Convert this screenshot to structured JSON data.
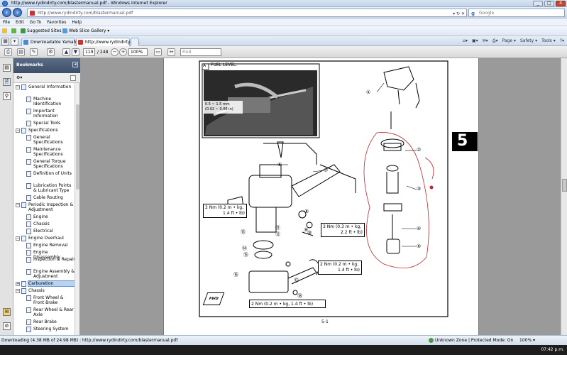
{
  "window": {
    "title": "http://www.rydindirty.com/blastermanual.pdf - Windows Internet Explorer",
    "controls": [
      "_",
      "□",
      "X"
    ]
  },
  "address_bar": {
    "url": "http://www.rydindirty.com/blastermanual.pdf",
    "search_placeholder": "Google"
  },
  "menu": [
    "File",
    "Edit",
    "Go To",
    "Favorites",
    "Help"
  ],
  "favorites_bar": {
    "suggested_sites": "Suggested Sites ▾",
    "web_slice": "Web Slice Gallery ▾"
  },
  "tabs": [
    {
      "label": "Downloadable Yamaha Bla..."
    },
    {
      "label": "http://www.rydindirty.co..."
    }
  ],
  "command_bar": [
    "Page ▾",
    "Safety ▾",
    "Tools ▾"
  ],
  "pdf_toolbar": {
    "page_current": "119",
    "page_total": "/ 248",
    "zoom": "100%",
    "find_placeholder": "Find"
  },
  "bookmarks_panel": {
    "title": "Bookmarks",
    "items": [
      {
        "label": "General Information",
        "level": 0,
        "toggle": "−"
      },
      {
        "label": "Machine Identification",
        "level": 1
      },
      {
        "label": "Important Information",
        "level": 1
      },
      {
        "label": "Special Tools",
        "level": 1
      },
      {
        "label": "Specifications",
        "level": 0,
        "toggle": "−"
      },
      {
        "label": "General Specifications",
        "level": 1
      },
      {
        "label": "Maintenance Specifications",
        "level": 1
      },
      {
        "label": "General Torque Specifications",
        "level": 1
      },
      {
        "label": "Definition of Units",
        "level": 1
      },
      {
        "label": "Lubrication Points & Lubricant Type",
        "level": 1
      },
      {
        "label": "Cable Routing",
        "level": 1
      },
      {
        "label": "Periodic Inspection & Adjustment",
        "level": 0,
        "toggle": "−"
      },
      {
        "label": "Engine",
        "level": 1
      },
      {
        "label": "Chassis",
        "level": 1
      },
      {
        "label": "Electrical",
        "level": 1
      },
      {
        "label": "Engine Overhaul",
        "level": 0,
        "toggle": "−"
      },
      {
        "label": "Engine Removal",
        "level": 1
      },
      {
        "label": "Engine Disassembly",
        "level": 1
      },
      {
        "label": "Inspection & Repair",
        "level": 1
      },
      {
        "label": "Engine Assembly & Adjustment",
        "level": 1
      },
      {
        "label": "Carburetion",
        "level": 0,
        "toggle": "+",
        "selected": true
      },
      {
        "label": "Chassis",
        "level": 0,
        "toggle": "−"
      },
      {
        "label": "Front Wheel & Front Brake",
        "level": 1
      },
      {
        "label": "Rear Wheel & Rear Axle",
        "level": 1
      },
      {
        "label": "Rear Brake",
        "level": 1
      },
      {
        "label": "Steering System",
        "level": 1
      }
    ]
  },
  "document": {
    "inset_label": "A",
    "inset_title": "FUEL LEVEL:",
    "inset_measure": "0.5 ~ 1.5 mm",
    "inset_measure2": "(0.02 ~ 0.06 in)",
    "section_number": "5",
    "page_footer": "5-1",
    "callouts": [
      "①",
      "②",
      "③",
      "④",
      "⑤",
      "⑥",
      "⑦",
      "⑧",
      "⑨",
      "⑩",
      "⑪",
      "⑫",
      "⑬",
      "⑭",
      "⑮",
      "⑯",
      "⑰",
      "⑱"
    ],
    "torques": [
      {
        "line1": "2 Nm (0.2 m • kg,",
        "line2": "1.4 ft • lb)"
      },
      {
        "line1": "3 Nm (0.3 m • kg,",
        "line2": "2.2 ft • lb)"
      },
      {
        "line1": "2 Nm (0.2 m • kg,",
        "line2": "1.4 ft • lb)"
      },
      {
        "line1": "2 Nm (0.2 m • kg, 1.4 ft • lb)",
        "line2": ""
      }
    ],
    "fwd_label": "FWD"
  },
  "status_bar": {
    "download": "Downloading (4.38 MB of 24.98 MB) : http://www.rydindirty.com/blastermanual.pdf",
    "zone": "Unknown Zone | Protected Mode: On",
    "zoom": "100% ▾"
  },
  "taskbar": {
    "clock": "07:42 p.m."
  }
}
